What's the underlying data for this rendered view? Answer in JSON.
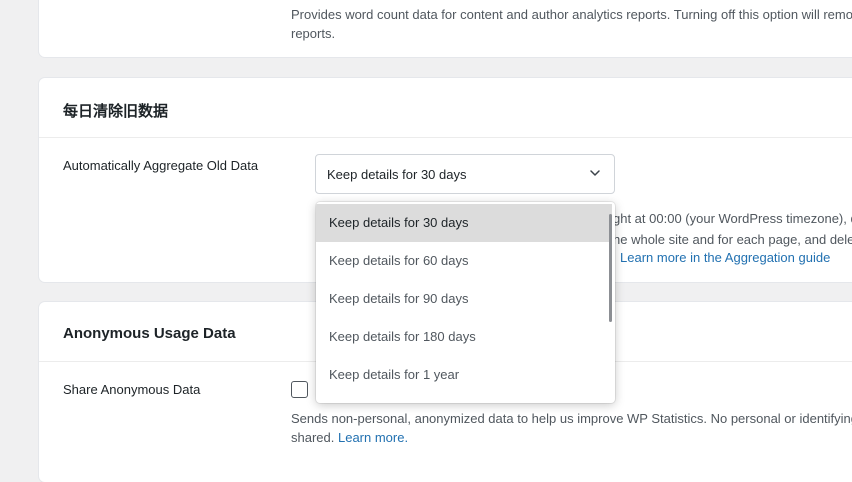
{
  "top_section": {
    "description_line1": "Provides word count data for content and author analytics reports. Turning off this option will remove",
    "description_line2": "reports."
  },
  "aggregate_section": {
    "title": "每日清除旧数据",
    "field_label": "Automatically Aggregate Old Data",
    "selected_value": "Keep details for 30 days",
    "desc_line1": "ght at 00:00 (your WordPress timezone), d",
    "desc_line2": "he whole site and for each page, and dele",
    "link_text": "Learn more in the Aggregation guide",
    "options": [
      "Keep details for 30 days",
      "Keep details for 60 days",
      "Keep details for 90 days",
      "Keep details for 180 days",
      "Keep details for 1 year"
    ]
  },
  "anonymous_section": {
    "title": "Anonymous Usage Data",
    "field_label": "Share Anonymous Data",
    "desc_line1": "Sends non-personal, anonymized data to help us improve WP Statistics. No personal or identifying",
    "desc_line2_prefix": "shared. ",
    "link_text": "Learn more."
  },
  "colors": {
    "background": "#f0f0f1",
    "card": "#ffffff",
    "link": "#2271b1",
    "selected_option": "#dcdcdc"
  },
  "icons": {
    "select_toggle": "chevron-down-icon"
  }
}
